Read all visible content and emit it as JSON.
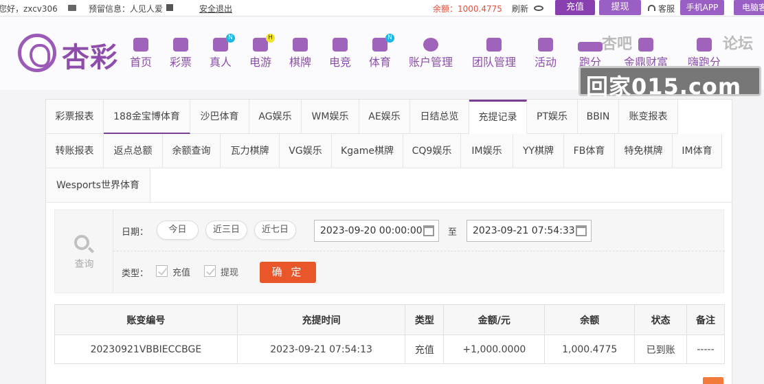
{
  "topbar": {
    "greeting": "您好，zxcv306",
    "reserved_label": "预留信息：人见人爱",
    "logout": "安全退出",
    "balance": "余额：1000.4775",
    "refresh": "刷新",
    "recharge": "充值",
    "withdraw": "提现",
    "service": "客服",
    "mobile_app": "手机APP",
    "pc_client": "电脑客"
  },
  "logo": {
    "text": "杏彩"
  },
  "nav": [
    {
      "label": "首页",
      "icon": "home-icon"
    },
    {
      "label": "彩票",
      "icon": "ticket-icon"
    },
    {
      "label": "真人",
      "icon": "person-icon",
      "badge": "N"
    },
    {
      "label": "电游",
      "icon": "gamepad-icon",
      "badge": "H"
    },
    {
      "label": "棋牌",
      "icon": "cards-icon"
    },
    {
      "label": "电竞",
      "icon": "joystick-icon"
    },
    {
      "label": "体育",
      "icon": "trophy-icon",
      "badge": "N"
    },
    {
      "label": "账户管理",
      "icon": "coin-icon"
    },
    {
      "label": "团队管理",
      "icon": "team-icon"
    },
    {
      "label": "活动",
      "icon": "gift-icon"
    },
    {
      "label": "跑分",
      "icon": "car-icon"
    },
    {
      "label": "金鼎财富",
      "icon": "wealth-icon"
    },
    {
      "label": "嗨跑分",
      "icon": "chart-icon"
    }
  ],
  "watermark": {
    "top_left": "杏吧",
    "top_right": "论坛",
    "main": "回家015.com"
  },
  "tabs_row1": [
    "彩票报表",
    "188金宝博体育",
    "沙巴体育",
    "AG娱乐",
    "WM娱乐",
    "AE娱乐",
    "日结总览",
    "充提记录",
    "PT娱乐",
    "BBIN",
    "账变报表"
  ],
  "tabs_row2": [
    "转账报表",
    "返点总额",
    "余额查询",
    "瓦力棋牌",
    "VG娱乐",
    "Kgame棋牌",
    "CQ9娱乐",
    "IM娱乐",
    "YY棋牌",
    "FB体育",
    "特免棋牌",
    "IM体育"
  ],
  "tabs_row3": [
    "Wesports世界体育"
  ],
  "active_tab": "充提记录",
  "query": {
    "title": "查询",
    "date_label": "日期：",
    "today": "今日",
    "three_days": "近三日",
    "seven_days": "近七日",
    "start": "2023-09-20 00:00:00",
    "to": "至",
    "end": "2023-09-21 07:54:33",
    "type_label": "类型：",
    "type_recharge": "充值",
    "type_withdraw": "提现",
    "confirm": "确 定"
  },
  "table": {
    "headers": [
      "账变编号",
      "充提时间",
      "类型",
      "金额/元",
      "余额",
      "状态",
      "备注"
    ],
    "rows": [
      [
        "20230921VBBIECCBGE",
        "2023-09-21 07:54:13",
        "充值",
        "+1,000.0000",
        "1,000.4775",
        "已到账",
        "-----"
      ]
    ]
  },
  "colors": {
    "brand": "#8c4fa9",
    "recharge_btn": "#8a3fb0",
    "withdraw_btn": "#9a5fc4",
    "confirm_btn": "#e8562a",
    "balance": "#e74c3c"
  }
}
